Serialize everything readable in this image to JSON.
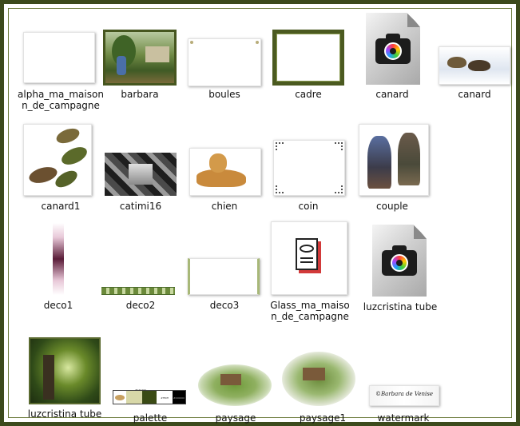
{
  "files": [
    {
      "label": "alpha_ma_maison\nn_de_campagne",
      "icon": "white-image-thumbnail"
    },
    {
      "label": "barbara",
      "icon": "garden-scene-thumbnail"
    },
    {
      "label": "boules",
      "icon": "white-frame-thumbnail"
    },
    {
      "label": "cadre",
      "icon": "green-frame-thumbnail"
    },
    {
      "label": "canard",
      "icon": "camera-file-icon"
    },
    {
      "label": "canard",
      "icon": "ducks-thumbnail"
    },
    {
      "label": "canard1",
      "icon": "flying-ducks-thumbnail"
    },
    {
      "label": "catimi16",
      "icon": "gray-pattern-thumbnail"
    },
    {
      "label": "chien",
      "icon": "dog-thumbnail"
    },
    {
      "label": "coin",
      "icon": "corner-frame-thumbnail"
    },
    {
      "label": "couple",
      "icon": "couple-thumbnail"
    },
    {
      "label": "deco1",
      "icon": "vertical-bar-thumbnail"
    },
    {
      "label": "deco2",
      "icon": "horizontal-border-thumbnail"
    },
    {
      "label": "deco3",
      "icon": "decorative-frame-thumbnail"
    },
    {
      "label": "Glass_ma_maiso\nn_de_campagne",
      "icon": "document-eye-icon"
    },
    {
      "label": "luzcristina tube",
      "icon": "camera-file-icon"
    },
    {
      "label": "luzcristina tube",
      "icon": "green-landscape-thumbnail"
    },
    {
      "label": "palette",
      "icon": "palette-thumbnail"
    },
    {
      "label": "paysage",
      "icon": "landscape-thumbnail"
    },
    {
      "label": "paysage1",
      "icon": "oval-landscape-thumbnail"
    },
    {
      "label": "watermark",
      "icon": "watermark-thumbnail"
    }
  ],
  "palette_codes": [
    "#b4b490",
    "#fff0ff",
    "#000000"
  ],
  "watermark_text": "©Barbara de Venise",
  "colors": {
    "frame": "#3c4a1c",
    "background": "#ffffff"
  }
}
